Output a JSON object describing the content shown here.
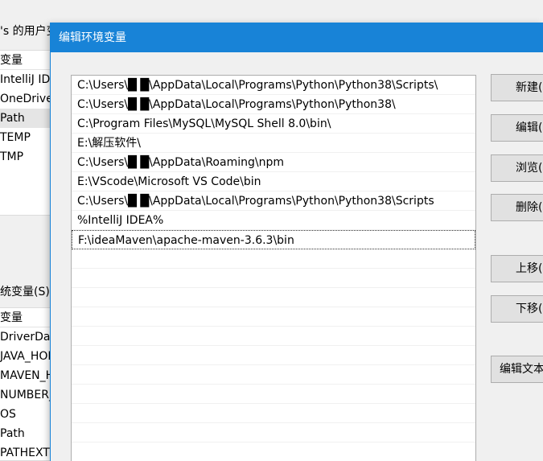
{
  "parent": {
    "user_vars_title": "'s 的用户变",
    "user_list_header": "变量",
    "user_vars": [
      "IntelliJ IDEA",
      "OneDriveC",
      "Path",
      "TEMP",
      "TMP"
    ],
    "system_vars_label": "统变量(S)",
    "system_list_header": "变量",
    "system_vars": [
      "DriverData",
      "JAVA_HOM",
      "MAVEN_H",
      "NUMBER_C",
      "OS",
      "Path",
      "PATHEXT"
    ]
  },
  "dialog": {
    "title": "编辑环境变量",
    "entries": [
      "C:\\Users\\█ █\\AppData\\Local\\Programs\\Python\\Python38\\Scripts\\",
      "C:\\Users\\█ █\\AppData\\Local\\Programs\\Python\\Python38\\",
      "C:\\Program Files\\MySQL\\MySQL Shell 8.0\\bin\\",
      "E:\\解压软件\\",
      "C:\\Users\\█ █\\AppData\\Roaming\\npm",
      "E:\\VScode\\Microsoft VS Code\\bin",
      "C:\\Users\\█ █\\AppData\\Local\\Programs\\Python\\Python38\\Scripts",
      "%IntelliJ IDEA%",
      "F:\\ideaMaven\\apache-maven-3.6.3\\bin"
    ],
    "buttons": {
      "new": "新建(N)",
      "edit": "编辑(E)",
      "browse": "浏览(B)...",
      "delete": "删除(D)",
      "move_up": "上移(U)",
      "move_down": "下移(O)",
      "edit_text": "编辑文本(T)..."
    }
  }
}
